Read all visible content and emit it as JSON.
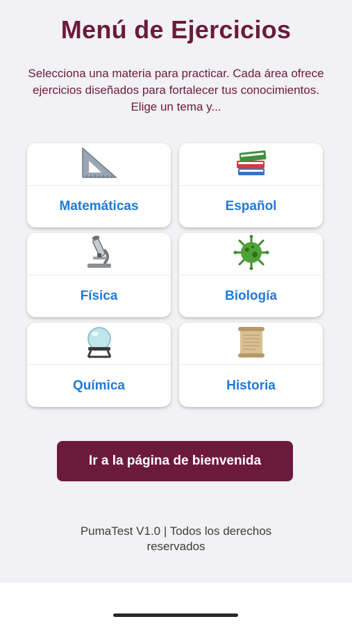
{
  "header": {
    "title": "Menú de Ejercicios",
    "subtitle": "Selecciona una materia para practicar. Cada área ofrece ejercicios diseñados para fortalecer tus conocimientos. Elige un tema y..."
  },
  "subjects": [
    {
      "label": "Matemáticas",
      "icon": "set-square-icon"
    },
    {
      "label": "Español",
      "icon": "books-icon"
    },
    {
      "label": "Física",
      "icon": "microscope-icon"
    },
    {
      "label": "Biología",
      "icon": "microbe-icon"
    },
    {
      "label": "Química",
      "icon": "crystal-ball-icon"
    },
    {
      "label": "Historia",
      "icon": "scroll-icon"
    }
  ],
  "welcome_button": {
    "label": "Ir a la página de bienvenida"
  },
  "footer": {
    "text": "PumaTest V1.0 | Todos los derechos reservados"
  },
  "colors": {
    "accent": "#6b1a3e",
    "link": "#1f7ad8",
    "background": "#f2f1f3"
  }
}
